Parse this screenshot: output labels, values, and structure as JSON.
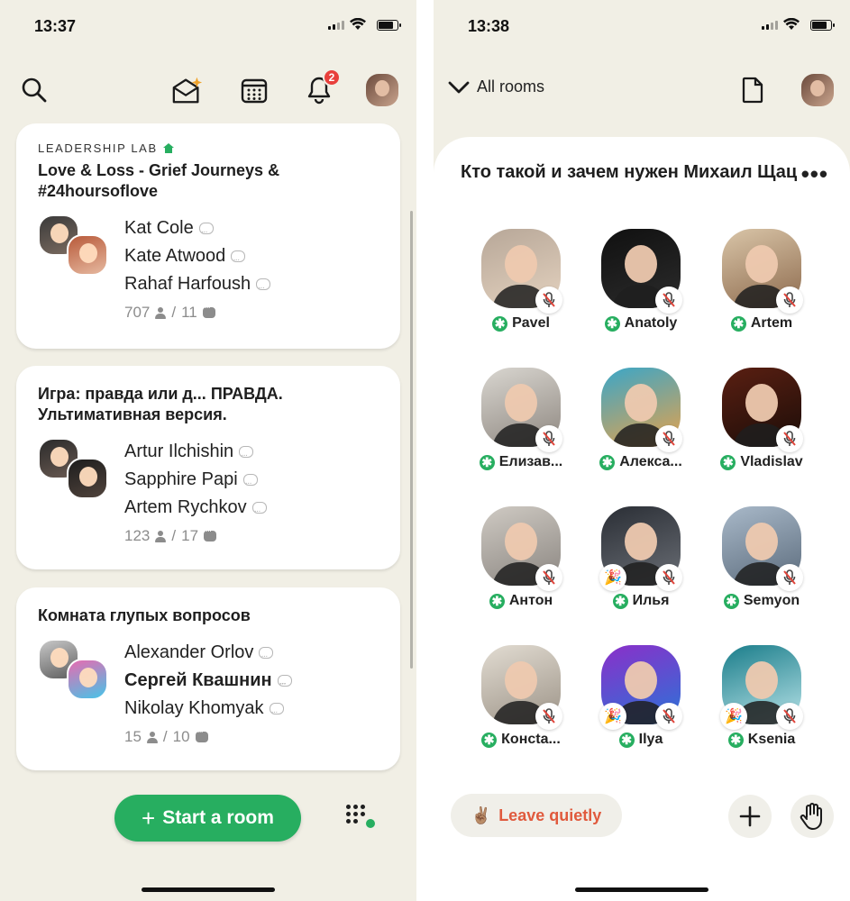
{
  "left": {
    "status_time": "13:37",
    "notification_count": "2",
    "rooms": [
      {
        "club": "LEADERSHIP LAB",
        "title": "Love & Loss - Grief Journeys & #24hoursoflove",
        "speakers": [
          "Kat Cole",
          "Kate Atwood",
          "Rahaf Harfoush"
        ],
        "listeners": "707",
        "chatting": "11"
      },
      {
        "club": "",
        "title": "Игра: правда или д... ПРАВДА. Ультимативная версия.",
        "speakers": [
          "Artur Ilchishin",
          "Sapphire Papi",
          "Artem Rychkov"
        ],
        "listeners": "123",
        "chatting": "17"
      },
      {
        "club": "",
        "title": "Комната глупых вопросов",
        "speakers": [
          "Alexander Orlov",
          "Сергей Квашнин",
          "Nikolay Khomyak"
        ],
        "listeners": "15",
        "chatting": "10"
      }
    ],
    "start_room_label": "Start a room",
    "colors": {
      "accent": "#27ae60",
      "background": "#f1efe5",
      "badge": "#e8403c"
    }
  },
  "right": {
    "status_time": "13:38",
    "back_label": "All rooms",
    "room_title": "Кто такой и зачем нужен Михаил Щац",
    "listeners": [
      {
        "name": "Pavel",
        "icon": "mic-off-icon"
      },
      {
        "name": "Anatoly",
        "icon": "mic-off-icon"
      },
      {
        "name": "Artem",
        "icon": "mic-off-icon"
      },
      {
        "name": "Елизав...",
        "icon": "mic-off-icon"
      },
      {
        "name": "Алекса...",
        "icon": "mic-off-icon"
      },
      {
        "name": "Vladislav",
        "icon": "mic-off-icon"
      },
      {
        "name": "Антон",
        "icon": "mic-off-icon"
      },
      {
        "name": "Илья",
        "icon": "mic-off-icon",
        "new_user": "party-popper-icon"
      },
      {
        "name": "Semyon",
        "icon": "mic-off-icon"
      },
      {
        "name": "Консta...",
        "icon": "mic-off-icon"
      },
      {
        "name": "Ilya",
        "icon": "mic-off-icon",
        "new_user": "party-popper-icon"
      },
      {
        "name": "Ksenia",
        "icon": "mic-off-icon",
        "new_user": "party-popper-icon"
      }
    ],
    "leave_label": "Leave quietly",
    "leave_emoji": "✌🏽"
  }
}
